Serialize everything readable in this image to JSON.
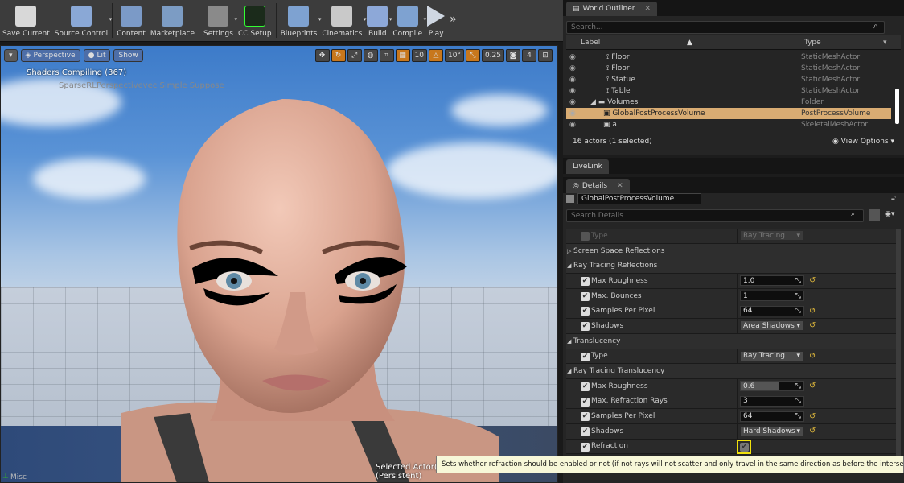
{
  "toolbar": {
    "buttons": [
      {
        "label": "Save Current",
        "icon": "save-icon"
      },
      {
        "label": "Source Control",
        "icon": "source-control-icon"
      },
      {
        "label": "Content",
        "icon": "content-icon"
      },
      {
        "label": "Marketplace",
        "icon": "marketplace-icon"
      },
      {
        "label": "Settings",
        "icon": "settings-icon"
      },
      {
        "label": "CC Setup",
        "icon": "cc-setup-icon"
      },
      {
        "label": "Blueprints",
        "icon": "blueprints-icon"
      },
      {
        "label": "Cinematics",
        "icon": "cinematics-icon"
      },
      {
        "label": "Build",
        "icon": "build-icon"
      },
      {
        "label": "Compile",
        "icon": "compile-icon"
      },
      {
        "label": "Play",
        "icon": "play-icon"
      }
    ],
    "more": "»"
  },
  "viewport": {
    "menu_icon": "▾",
    "perspective": "Perspective",
    "lit": "Lit",
    "show": "Show",
    "grid_snap": "10",
    "angle_snap": "10°",
    "scale_snap": "0.25",
    "camera_speed": "4",
    "shaders": "Shaders Compiling (367)",
    "shaders_sub": "SparseRLPerspectivevec Simple Suppose",
    "selected_actor": "Selected Actor(s) in: Minimal_Default (Persistent)"
  },
  "outliner": {
    "tab": "World Outliner",
    "search_placeholder": "Search...",
    "col_label": "Label",
    "col_type": "Type",
    "rows": [
      {
        "name": "Floor",
        "type": "StaticMeshActor",
        "selected": false
      },
      {
        "name": "Floor",
        "type": "StaticMeshActor",
        "selected": false
      },
      {
        "name": "Statue",
        "type": "StaticMeshActor",
        "selected": false
      },
      {
        "name": "Table",
        "type": "StaticMeshActor",
        "selected": false
      },
      {
        "name": "Volumes",
        "type": "Folder",
        "selected": false
      },
      {
        "name": "GlobalPostProcessVolume",
        "type": "PostProcessVolume",
        "selected": true
      },
      {
        "name": "a",
        "type": "SkeletalMeshActor",
        "selected": false
      }
    ],
    "count": "16 actors (1 selected)",
    "view_options": "View Options"
  },
  "livelink": {
    "tab": "LiveLink"
  },
  "details": {
    "tab": "Details",
    "actor_name": "GlobalPostProcessVolume",
    "search_placeholder": "Search Details",
    "rows": [
      {
        "kind": "prop",
        "label": "Type",
        "checked": false,
        "control": "combo",
        "value": "Ray Tracing",
        "dim": true,
        "reset": false
      },
      {
        "kind": "cat",
        "label": "Screen Space Reflections",
        "arrow": "▷"
      },
      {
        "kind": "cat",
        "label": "Ray Tracing Reflections",
        "arrow": "◢"
      },
      {
        "kind": "prop",
        "label": "Max Roughness",
        "checked": true,
        "control": "val",
        "value": "1.0",
        "reset": true
      },
      {
        "kind": "prop",
        "label": "Max. Bounces",
        "checked": true,
        "control": "val",
        "value": "1",
        "reset": false
      },
      {
        "kind": "prop",
        "label": "Samples Per Pixel",
        "checked": true,
        "control": "val",
        "value": "64",
        "reset": true
      },
      {
        "kind": "prop",
        "label": "Shadows",
        "checked": true,
        "control": "combo",
        "value": "Area Shadows",
        "reset": true
      },
      {
        "kind": "cat",
        "label": "Translucency",
        "arrow": "◢"
      },
      {
        "kind": "prop",
        "label": "Type",
        "checked": true,
        "control": "combo",
        "value": "Ray Tracing",
        "reset": true
      },
      {
        "kind": "cat",
        "label": "Ray Tracing Translucency",
        "arrow": "◢"
      },
      {
        "kind": "prop",
        "label": "Max Roughness",
        "checked": true,
        "control": "val",
        "value": "0.6",
        "reset": true
      },
      {
        "kind": "prop",
        "label": "Max. Refraction Rays",
        "checked": true,
        "control": "val",
        "value": "3",
        "reset": false
      },
      {
        "kind": "prop",
        "label": "Samples Per Pixel",
        "checked": true,
        "control": "val",
        "value": "64",
        "reset": true
      },
      {
        "kind": "prop",
        "label": "Shadows",
        "checked": true,
        "control": "combo",
        "value": "Hard Shadows",
        "reset": true
      },
      {
        "kind": "prop",
        "label": "Refraction",
        "checked": true,
        "control": "check",
        "value": "",
        "reset": false
      }
    ],
    "misc": "Misc"
  },
  "tooltip": "Sets whether refraction should be enabled or not (if not rays will not scatter and only travel in the same direction as before the intersection event).",
  "colors": {
    "selection": "#d9ac73",
    "highlight": "#f1e10b",
    "panel": "#252525"
  }
}
